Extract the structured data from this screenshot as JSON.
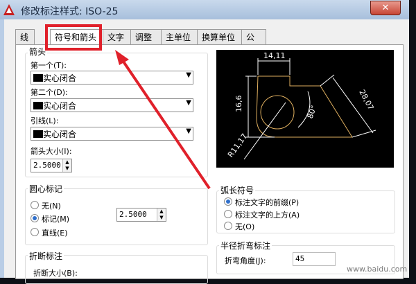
{
  "window": {
    "title": "修改标注样式: ISO-25",
    "close_symbol": "✕"
  },
  "tabs": [
    "线",
    "符号和箭头",
    "文字",
    "调整",
    "主单位",
    "换算单位",
    "公差"
  ],
  "arrowheads": {
    "group_label": "箭头",
    "first_label": "第一个(T):",
    "first_value": "实心闭合",
    "second_label": "第二个(D):",
    "second_value": "实心闭合",
    "leader_label": "引线(L):",
    "leader_value": "实心闭合",
    "size_label": "箭头大小(I):",
    "size_value": "2.5000"
  },
  "center_marks": {
    "group_label": "圆心标记",
    "options": [
      "无(N)",
      "标记(M)",
      "直线(E)"
    ],
    "selected": "标记(M)",
    "size_value": "2.5000"
  },
  "arc_length": {
    "group_label": "弧长符号",
    "options": [
      "标注文字的前缀(P)",
      "标注文字的上方(A)",
      "无(O)"
    ],
    "selected": "标注文字的前缀(P)"
  },
  "break": {
    "group_label": "折断标注",
    "size_label": "折断大小(B):"
  },
  "jog": {
    "group_label": "半径折弯标注",
    "angle_label": "折弯角度(J):",
    "angle_value": "45"
  },
  "preview": {
    "dim_top": "14,11",
    "dim_left": "16,6",
    "dim_diag": "28,07",
    "dim_angle": "80°",
    "dim_radius": "R11,17"
  },
  "colors": {
    "highlight": "#e0202a",
    "preview_bg": "#000000",
    "preview_geometry": "#e0b060"
  },
  "watermark": "www.baidu.com"
}
